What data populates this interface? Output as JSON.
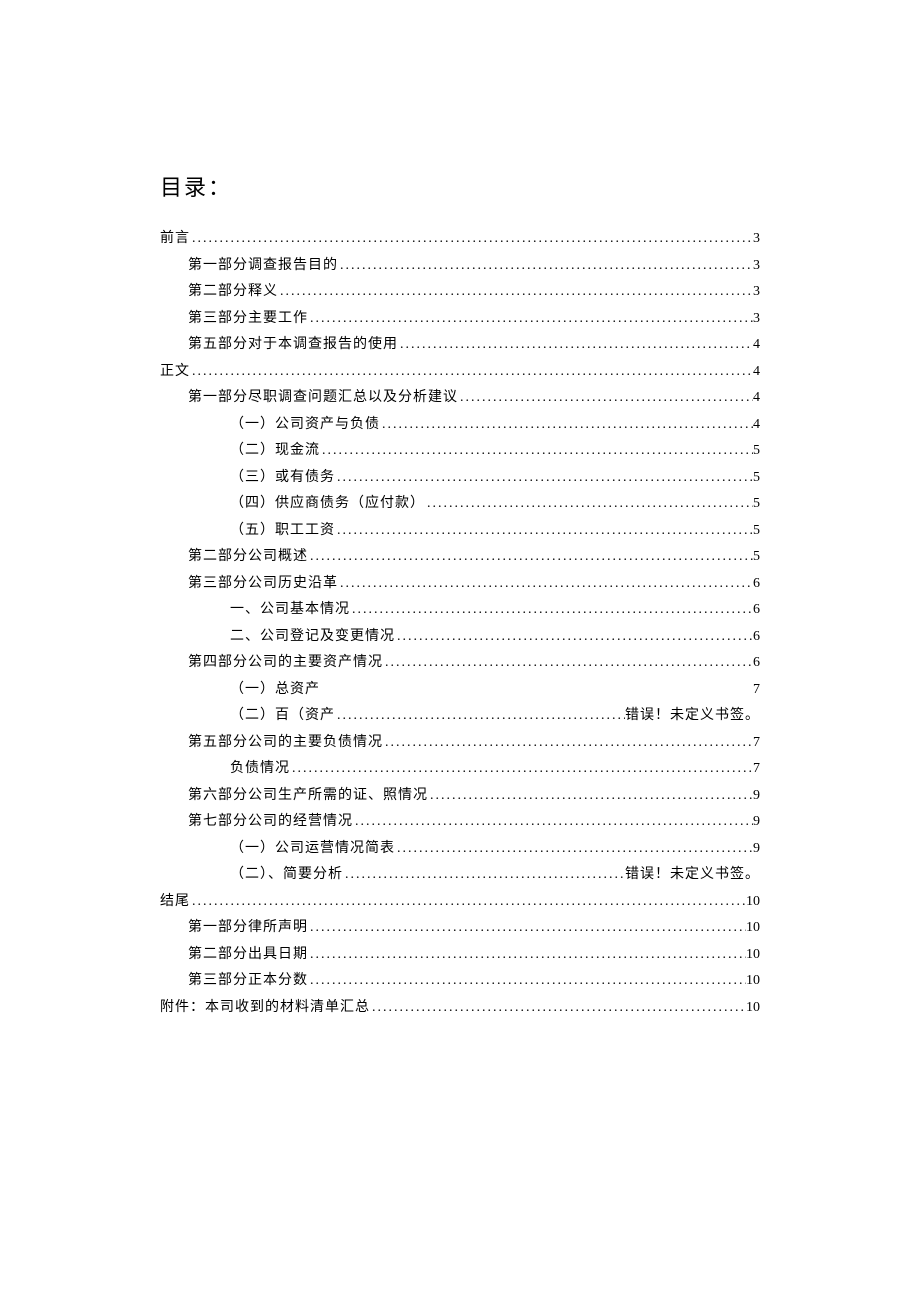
{
  "title": "目录：",
  "entries": [
    {
      "text": "前言",
      "page": "3",
      "indent": 0
    },
    {
      "text": "第一部分调查报告目的",
      "page": "3",
      "indent": 1
    },
    {
      "text": "第二部分释义",
      "page": "3",
      "indent": 1
    },
    {
      "text": "第三部分主要工作",
      "page": "3",
      "indent": 1
    },
    {
      "text": "第五部分对于本调查报告的使用",
      "page": "4",
      "indent": 1
    },
    {
      "text": "正文",
      "page": "4",
      "indent": 0
    },
    {
      "text": "第一部分尽职调查问题汇总以及分析建议",
      "page": "4",
      "indent": 1
    },
    {
      "text": "（一）公司资产与负债",
      "page": "4",
      "indent": 2
    },
    {
      "text": "（二）现金流",
      "page": "5",
      "indent": 2
    },
    {
      "text": "（三）或有债务",
      "page": "5",
      "indent": 2
    },
    {
      "text": "（四）供应商债务（应付款）",
      "page": "5",
      "indent": 2
    },
    {
      "text": "（五）职工工资",
      "page": "5",
      "indent": 2
    },
    {
      "text": "第二部分公司概述",
      "page": "5",
      "indent": 1
    },
    {
      "text": "第三部分公司历史沿革",
      "page": "6",
      "indent": 1
    },
    {
      "text": "一、公司基本情况",
      "page": "6",
      "indent": 2
    },
    {
      "text": "二、公司登记及变更情况",
      "page": "6",
      "indent": 2
    },
    {
      "text": "第四部分公司的主要资产情况",
      "page": "6",
      "indent": 1
    },
    {
      "text": "（一）总资产",
      "page": "7",
      "indent": 2,
      "noLeader": true
    },
    {
      "text": "（二）百（资产",
      "page": "错误！未定义书签。",
      "indent": 2,
      "error": true
    },
    {
      "text": "第五部分公司的主要负债情况",
      "page": "7",
      "indent": 1
    },
    {
      "text": "负债情况",
      "page": "7",
      "indent": 2
    },
    {
      "text": "第六部分公司生产所需的证、照情况",
      "page": "9",
      "indent": 1
    },
    {
      "text": "第七部分公司的经营情况",
      "page": "9",
      "indent": 1
    },
    {
      "text": "（一）公司运营情况简表",
      "page": "9",
      "indent": 2
    },
    {
      "text": "（二）、简要分析",
      "page": "错误！未定义书签。",
      "indent": 2,
      "error": true
    },
    {
      "text": "结尾",
      "page": "10",
      "indent": 0
    },
    {
      "text": "第一部分律所声明",
      "page": "10",
      "indent": 1
    },
    {
      "text": "第二部分出具日期",
      "page": "10",
      "indent": 1
    },
    {
      "text": "第三部分正本分数",
      "page": "10",
      "indent": 1
    },
    {
      "text": "附件：本司收到的材料清单汇总",
      "page": "10",
      "indent": 0
    }
  ]
}
